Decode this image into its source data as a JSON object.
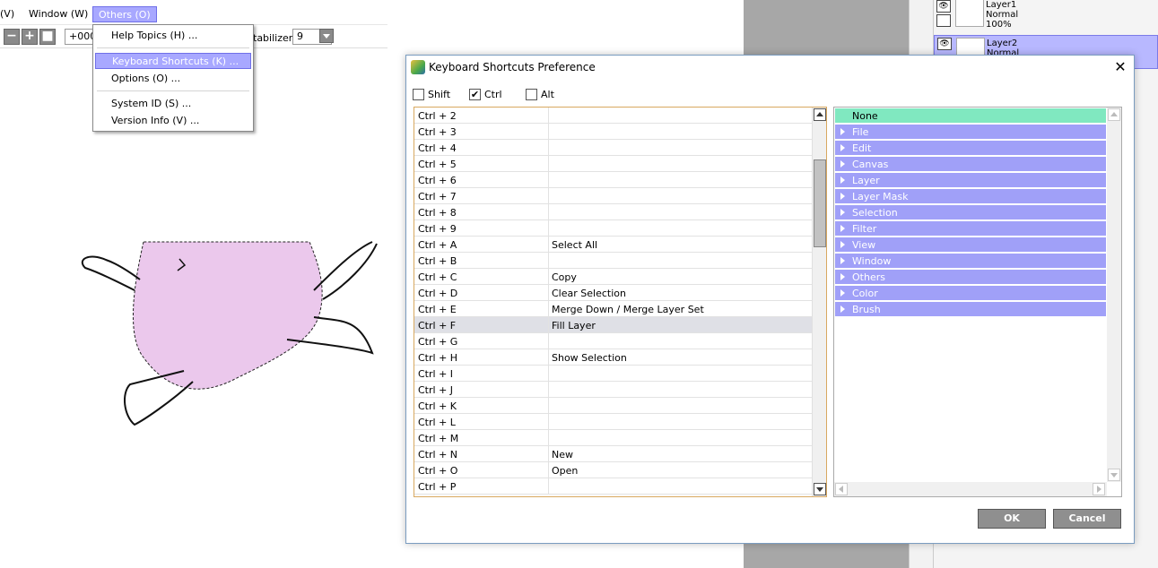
{
  "menubar": {
    "items": [
      {
        "label": "(V)"
      },
      {
        "label": "Window (W)"
      },
      {
        "label": "Others (O)"
      }
    ]
  },
  "toolbar": {
    "minus": "−",
    "plus": "+",
    "square": "■",
    "value": "+000",
    "stabilizer_label": "tabilizer",
    "stabilizer_value": "9"
  },
  "others_menu": {
    "items": [
      {
        "label": "Help Topics (H) ..."
      },
      {
        "label": "Keyboard Shortcuts (K) ..."
      },
      {
        "label": "Options (O) ..."
      },
      {
        "label": "System ID (S) ..."
      },
      {
        "label": "Version Info (V) ..."
      }
    ]
  },
  "layers_panel": {
    "layers": [
      {
        "name": "Layer1",
        "mode": "Normal",
        "opacity": "100%"
      },
      {
        "name": "Layer2",
        "mode": "Normal"
      }
    ]
  },
  "dialog": {
    "title": "Keyboard Shortcuts Preference",
    "close": "✕",
    "modifiers": [
      {
        "label": "Shift",
        "checked": false,
        "mark": ""
      },
      {
        "label": "Ctrl",
        "checked": true,
        "mark": "✔"
      },
      {
        "label": "Alt",
        "checked": false,
        "mark": ""
      }
    ],
    "shortcuts": [
      {
        "key": "Ctrl + 2",
        "action": ""
      },
      {
        "key": "Ctrl + 3",
        "action": ""
      },
      {
        "key": "Ctrl + 4",
        "action": ""
      },
      {
        "key": "Ctrl + 5",
        "action": ""
      },
      {
        "key": "Ctrl + 6",
        "action": ""
      },
      {
        "key": "Ctrl + 7",
        "action": ""
      },
      {
        "key": "Ctrl + 8",
        "action": ""
      },
      {
        "key": "Ctrl + 9",
        "action": ""
      },
      {
        "key": "Ctrl + A",
        "action": "Select All"
      },
      {
        "key": "Ctrl + B",
        "action": ""
      },
      {
        "key": "Ctrl + C",
        "action": "Copy"
      },
      {
        "key": "Ctrl + D",
        "action": "Clear Selection"
      },
      {
        "key": "Ctrl + E",
        "action": "Merge Down / Merge Layer Set"
      },
      {
        "key": "Ctrl + F",
        "action": "Fill Layer"
      },
      {
        "key": "Ctrl + G",
        "action": ""
      },
      {
        "key": "Ctrl + H",
        "action": "Show Selection"
      },
      {
        "key": "Ctrl + I",
        "action": ""
      },
      {
        "key": "Ctrl + J",
        "action": ""
      },
      {
        "key": "Ctrl + K",
        "action": ""
      },
      {
        "key": "Ctrl + L",
        "action": ""
      },
      {
        "key": "Ctrl + M",
        "action": ""
      },
      {
        "key": "Ctrl + N",
        "action": "New"
      },
      {
        "key": "Ctrl + O",
        "action": "Open"
      },
      {
        "key": "Ctrl + P",
        "action": ""
      }
    ],
    "categories": [
      {
        "label": "None"
      },
      {
        "label": "File"
      },
      {
        "label": "Edit"
      },
      {
        "label": "Canvas"
      },
      {
        "label": "Layer"
      },
      {
        "label": "Layer Mask"
      },
      {
        "label": "Selection"
      },
      {
        "label": "Filter"
      },
      {
        "label": "View"
      },
      {
        "label": "Window"
      },
      {
        "label": "Others"
      },
      {
        "label": "Color"
      },
      {
        "label": "Brush"
      }
    ],
    "ok_label": "OK",
    "cancel_label": "Cancel"
  }
}
